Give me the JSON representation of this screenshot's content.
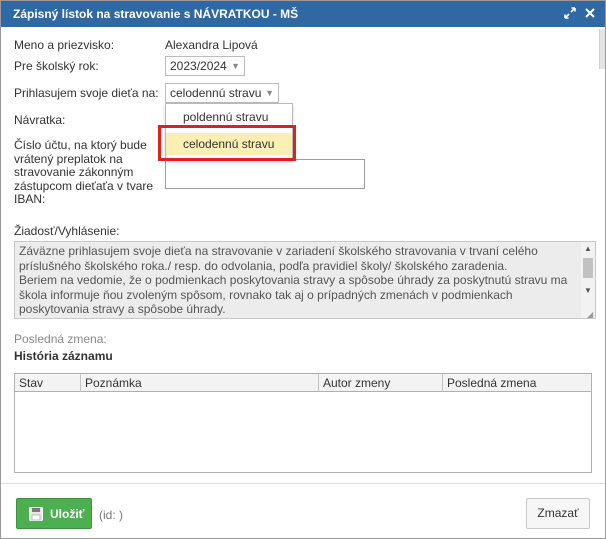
{
  "dialog": {
    "title": "Zápisný lístok na stravovanie s NÁVRATKOU - MŠ",
    "maximize_icon": "expand-arrows-icon",
    "close_icon": "close-icon"
  },
  "form": {
    "name_label": "Meno a priezvisko:",
    "name_value": "Alexandra Lipová",
    "school_year_label": "Pre školský rok:",
    "school_year_value": "2023/2024",
    "enroll_label": "Prihlasujem svoje dieťa na:",
    "enroll_value": "celodennú stravu",
    "return_label": "Návratka:",
    "account_label_lines": [
      "Číslo účtu, na ktorý bude",
      "vrátený preplatok na",
      "stravovanie zákonným",
      "zástupcom dieťaťa v tvare",
      "IBAN:"
    ],
    "iban_value": "",
    "request_label": "Žiadosť/Vyhlásenie:",
    "request_text_lines": [
      "Záväzne prihlasujem svoje dieťa na stravovanie v zariadení školského stravovania v trvaní celého",
      "príslušného školského roka./ resp. do odvolania, podľa pravidiel školy/ školského zaradenia.",
      "Beriem na vedomie, že o podmienkach poskytovania stravy a spôsobe úhrady za poskytnutú stravu  ma",
      "škola informuje ňou zvoleným spôsom, rovnako tak aj o prípadných zmenách v podmienkach",
      "poskytovania stravy a spôsobe úhrady."
    ],
    "last_change_label": "Posledná zmena:"
  },
  "dropdown": {
    "options": [
      "poldennú stravu",
      "celodennú stravu"
    ],
    "selected_index": 1
  },
  "history": {
    "title": "História záznamu",
    "columns": [
      "Stav",
      "Poznámka",
      "Autor zmeny",
      "Posledná zmena"
    ],
    "rows": []
  },
  "footer": {
    "save_label": "Uložiť",
    "save_icon": "floppy-disk-icon",
    "id_text": "(id: )",
    "delete_label": "Zmazať"
  },
  "colors": {
    "titlebar": "#2f68a3",
    "save_button": "#4caf50",
    "selected_option": "#fbefb4",
    "highlight": "#e02020"
  }
}
